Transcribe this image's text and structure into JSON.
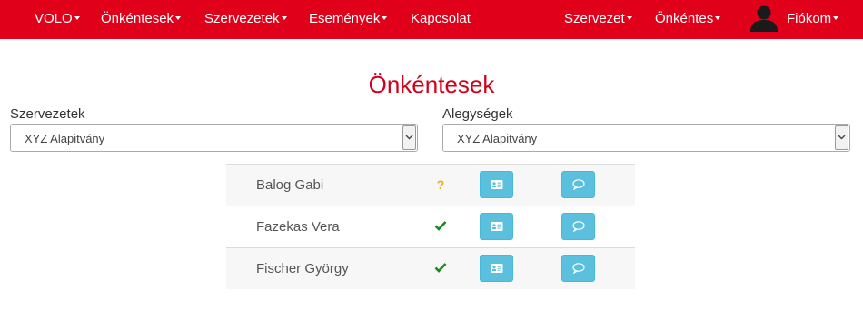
{
  "navbar": {
    "brand": "VOLO",
    "left_items": [
      {
        "label": "Önkéntesek"
      },
      {
        "label": "Szervezetek"
      },
      {
        "label": "Események"
      },
      {
        "label": "Kapcsolat"
      }
    ],
    "right_items": [
      {
        "label": "Szervezet"
      },
      {
        "label": "Önkéntes"
      }
    ],
    "account": {
      "label": "Fiókom",
      "icon": "user-icon"
    }
  },
  "page_title": "Önkéntesek",
  "filters": {
    "organizations": {
      "label": "Szervezetek",
      "value": "XYZ Alapitvány"
    },
    "units": {
      "label": "Alegységek",
      "value": "XYZ Alapitvány"
    }
  },
  "volunteers": [
    {
      "name": "Balog Gabi",
      "status": "pending",
      "status_icon": "question-mark-icon",
      "status_text": "?"
    },
    {
      "name": "Fazekas Vera",
      "status": "approved",
      "status_icon": "checkmark-icon"
    },
    {
      "name": "Fischer György",
      "status": "approved",
      "status_icon": "checkmark-icon"
    }
  ],
  "row_actions": [
    {
      "icon": "profile-card-icon"
    },
    {
      "icon": "message-bubble-icon"
    }
  ],
  "colors": {
    "navbar": "#e0001a",
    "title": "#d0021b",
    "info_button": "#5bc0de",
    "check": "#1a8a1a",
    "pending": "#f0ad1e"
  }
}
